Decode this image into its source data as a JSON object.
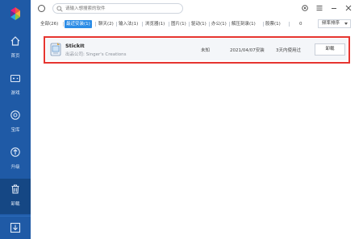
{
  "sidebar": {
    "items": [
      {
        "label": "首页",
        "icon": "home-icon"
      },
      {
        "label": "游戏",
        "icon": "gamepad-icon"
      },
      {
        "label": "宝库",
        "icon": "treasure-icon"
      },
      {
        "label": "升级",
        "icon": "upgrade-icon"
      },
      {
        "label": "卸载",
        "icon": "trash-icon",
        "active": true
      }
    ],
    "bottom_icon": "download-icon"
  },
  "search": {
    "placeholder": "请输入想搜索的软件"
  },
  "tabs": [
    {
      "label": "全部(26)"
    },
    {
      "label": "最近安装(1)",
      "active": true
    },
    {
      "label": "聊天(2)"
    },
    {
      "label": "输入法(1)"
    },
    {
      "label": "浏览器(1)"
    },
    {
      "label": "图片(1)"
    },
    {
      "label": "驱动(1)"
    },
    {
      "label": "办公(1)"
    },
    {
      "label": "解压刻录(1)"
    },
    {
      "label": "股票(1)"
    },
    {
      "label": "0"
    }
  ],
  "sort": {
    "label": "频率排序"
  },
  "app": {
    "name": "StickIt",
    "publisher": "出品公司: Singer's Creations",
    "size": "未知",
    "install_date": "2021/04/07安装",
    "usage": "3天内使用过",
    "uninstall_label": "卸载"
  },
  "colors": {
    "sidebar": "#1f5aa6",
    "sidebar_active": "#154784",
    "accent": "#2b8ce6",
    "highlight": "#e63530"
  }
}
